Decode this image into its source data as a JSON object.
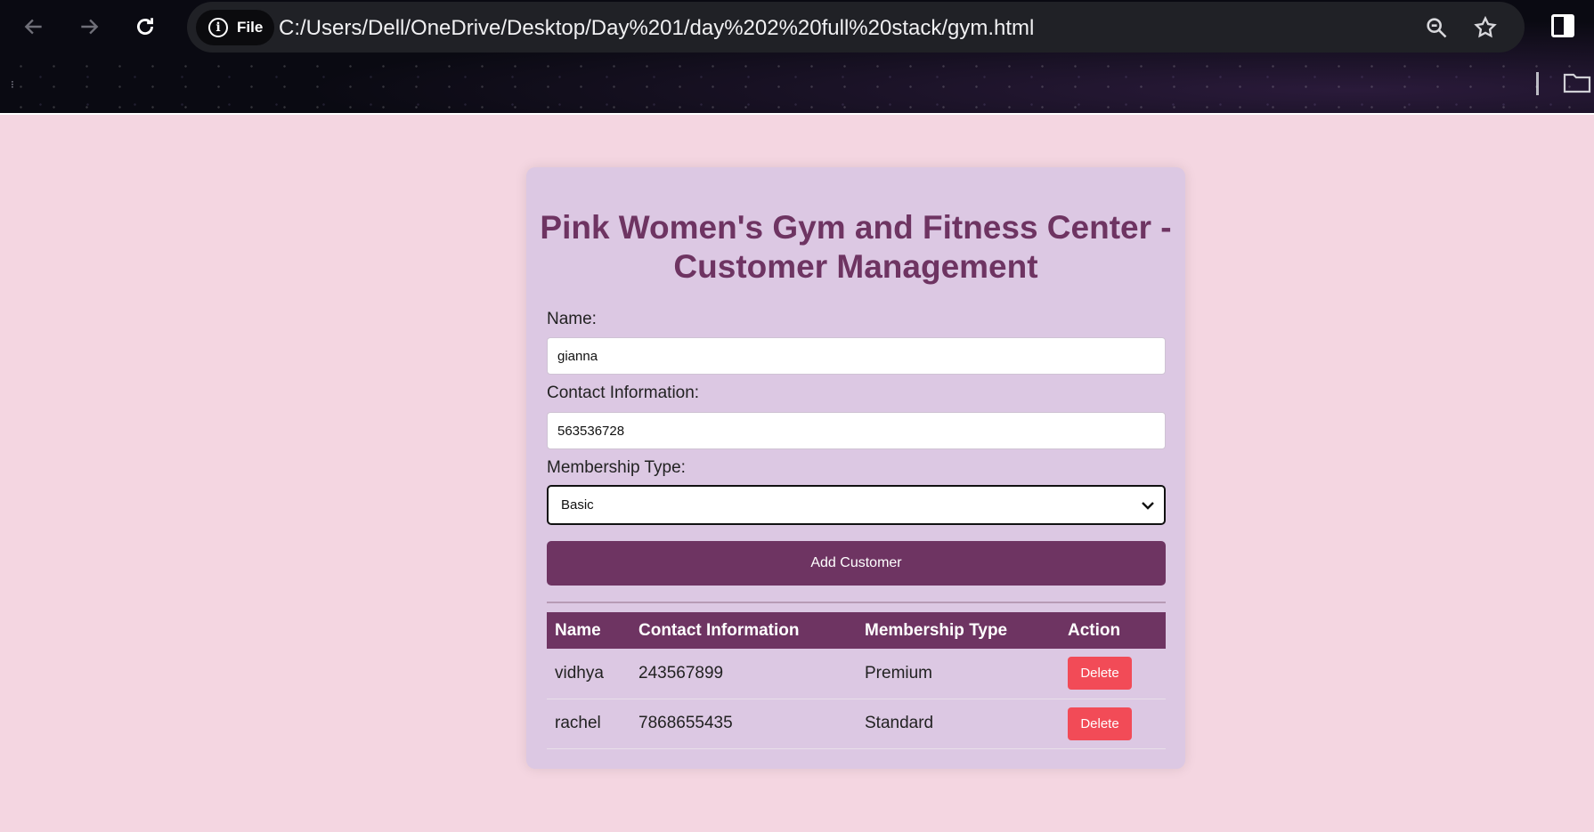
{
  "browser": {
    "file_chip_label": "File",
    "url": "C:/Users/Dell/OneDrive/Desktop/Day%201/day%202%20full%20stack/gym.html"
  },
  "page": {
    "title": "Pink Women's Gym and Fitness Center - Customer Management",
    "form": {
      "name_label": "Name:",
      "name_value": "gianna",
      "contact_label": "Contact Information:",
      "contact_value": "563536728",
      "membership_label": "Membership Type:",
      "membership_value": "Basic",
      "add_button_label": "Add Customer"
    },
    "table": {
      "headers": [
        "Name",
        "Contact Information",
        "Membership Type",
        "Action"
      ],
      "rows": [
        {
          "name": "vidhya",
          "contact": "243567899",
          "membership": "Premium",
          "action": "Delete"
        },
        {
          "name": "rachel",
          "contact": "7868655435",
          "membership": "Standard",
          "action": "Delete"
        }
      ]
    }
  },
  "colors": {
    "page_background": "#f4d6e1",
    "card_background": "#dcc8e3",
    "accent": "#6e3462",
    "delete": "#f24b57"
  },
  "icons": [
    "back-icon",
    "forward-icon",
    "reload-icon",
    "info-icon",
    "zoom-icon",
    "star-icon",
    "side-panel-icon",
    "folder-icon",
    "chevron-down-icon"
  ]
}
